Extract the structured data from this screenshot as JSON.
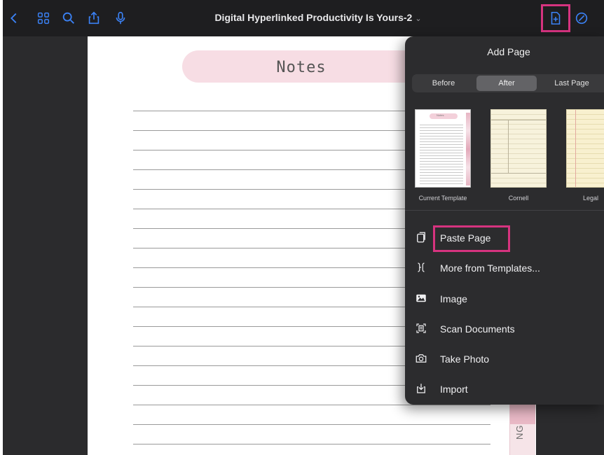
{
  "toolbar": {
    "document_title": "Digital Hyperlinked Productivity Is Yours-2",
    "title_chevron": "⌄"
  },
  "page": {
    "notes_title": "Notes",
    "side_tab_text": "NG"
  },
  "add_page": {
    "title": "Add Page",
    "segments": [
      "Before",
      "After",
      "Last Page"
    ],
    "selected_segment": "After",
    "templates": [
      {
        "label": "Current Template",
        "mini_title": "Notes"
      },
      {
        "label": "Cornell"
      },
      {
        "label": "Legal"
      }
    ],
    "menu": [
      {
        "label": "Paste Page",
        "icon": "paste-icon"
      },
      {
        "label": "More from Templates...",
        "icon": "templates-icon"
      },
      {
        "label": "Image",
        "icon": "image-icon"
      },
      {
        "label": "Scan Documents",
        "icon": "scan-icon"
      },
      {
        "label": "Take Photo",
        "icon": "camera-icon"
      },
      {
        "label": "Import",
        "icon": "import-icon"
      }
    ]
  },
  "colors": {
    "accent_blue": "#3b82f6",
    "highlight_pink": "#d6337f",
    "notes_pill": "#f7dde4",
    "popover_bg": "#2c2c2e"
  }
}
